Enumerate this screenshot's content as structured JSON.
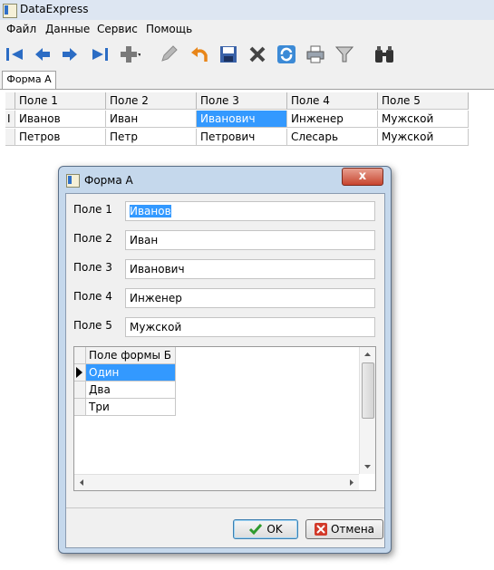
{
  "app": {
    "title": "DataExpress"
  },
  "menu": [
    "Файл",
    "Данные",
    "Сервис",
    "Помощь"
  ],
  "toolbar": {
    "icons": [
      "first-icon",
      "prev-icon",
      "next-icon",
      "last-icon",
      "add-icon",
      "edit-icon",
      "undo-icon",
      "save-icon",
      "delete-icon",
      "refresh-icon",
      "print-icon",
      "filter-icon",
      "find-icon"
    ]
  },
  "tabs": [
    {
      "label": "Форма А"
    }
  ],
  "grid": {
    "columns": [
      "Поле 1",
      "Поле 2",
      "Поле 3",
      "Поле 4",
      "Поле 5"
    ],
    "rows": [
      [
        "Иванов",
        "Иван",
        "Иванович",
        "Инженер",
        "Мужской"
      ],
      [
        "Петров",
        "Петр",
        "Петрович",
        "Слесарь",
        "Мужской"
      ]
    ],
    "row_marker": "I"
  },
  "dialog": {
    "title": "Форма А",
    "close_label": "x",
    "fields": [
      {
        "label": "Поле 1",
        "value": "Иванов"
      },
      {
        "label": "Поле 2",
        "value": "Иван"
      },
      {
        "label": "Поле 3",
        "value": "Иванович"
      },
      {
        "label": "Поле 4",
        "value": "Инженер"
      },
      {
        "label": "Поле 5",
        "value": "Мужской"
      }
    ],
    "subgrid": {
      "column": "Поле формы Б",
      "rows": [
        "Один",
        "Два",
        "Три"
      ]
    },
    "ok_label": "OK",
    "cancel_label": "Отмена"
  },
  "colors": {
    "selection": "#3399ff",
    "close": "#c7452f",
    "dialog_frame": "#c5d8ec"
  }
}
